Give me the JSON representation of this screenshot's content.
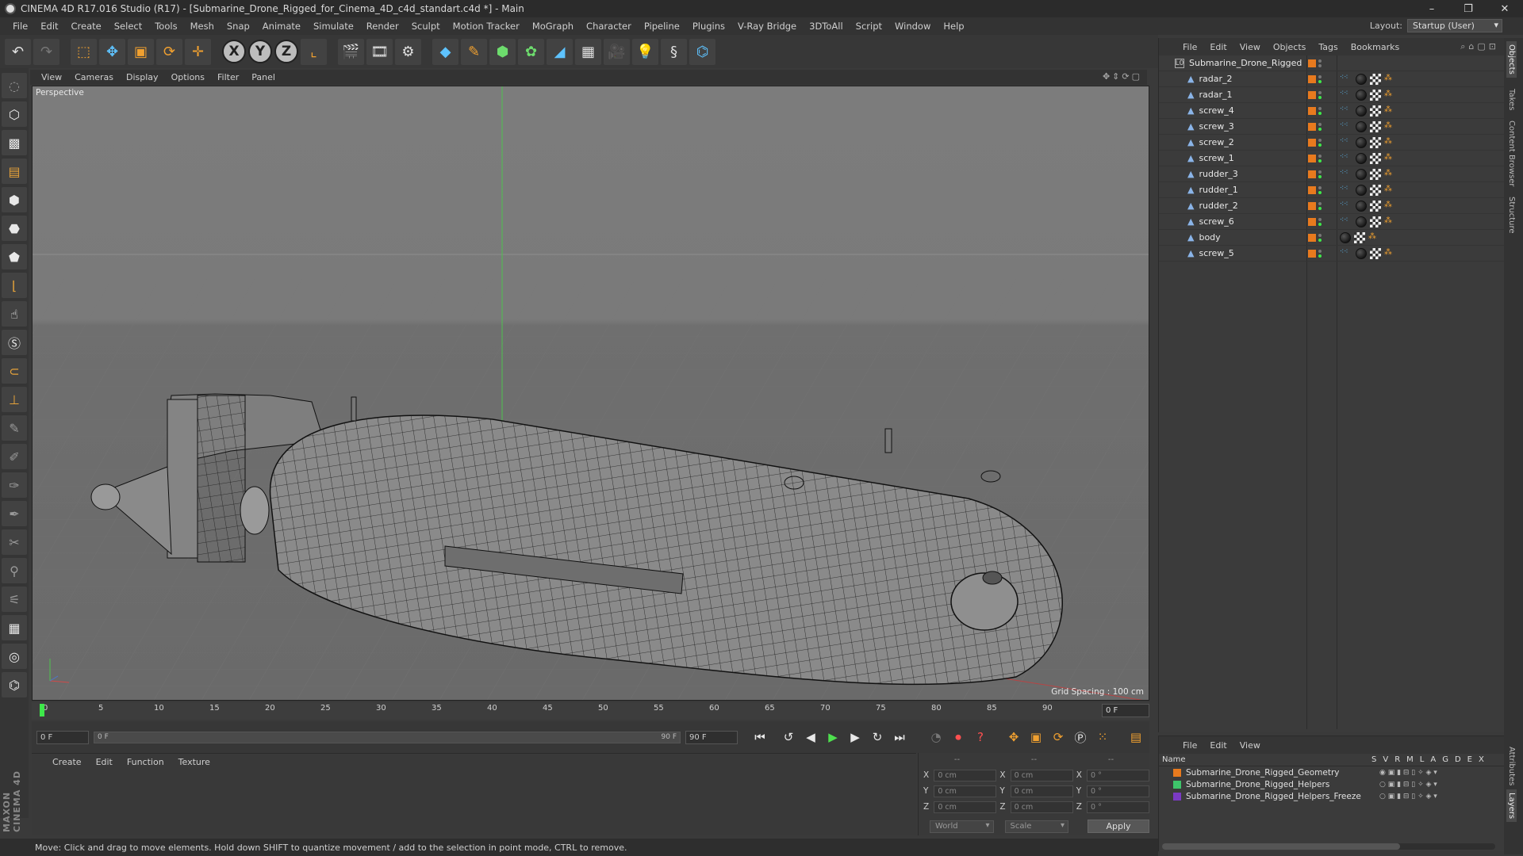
{
  "window": {
    "title": "CINEMA 4D R17.016 Studio (R17) - [Submarine_Drone_Rigged_for_Cinema_4D_c4d_standart.c4d *] - Main",
    "min": "–",
    "restore": "❐",
    "close": "✕"
  },
  "menu": [
    "File",
    "Edit",
    "Create",
    "Select",
    "Tools",
    "Mesh",
    "Snap",
    "Animate",
    "Simulate",
    "Render",
    "Sculpt",
    "Motion Tracker",
    "MoGraph",
    "Character",
    "Pipeline",
    "Plugins",
    "V-Ray Bridge",
    "3DToAll",
    "Script",
    "Window",
    "Help"
  ],
  "layout": {
    "label": "Layout:",
    "value": "Startup (User)"
  },
  "toolbar": {
    "x": "X",
    "y": "Y",
    "z": "Z"
  },
  "viewport": {
    "menu": [
      "View",
      "Cameras",
      "Display",
      "Options",
      "Filter",
      "Panel"
    ],
    "label": "Perspective",
    "grid_spacing": "Grid Spacing : 100 cm"
  },
  "timeline": {
    "ticks": [
      "0",
      "5",
      "10",
      "15",
      "20",
      "25",
      "30",
      "35",
      "40",
      "45",
      "50",
      "55",
      "60",
      "65",
      "70",
      "75",
      "80",
      "85",
      "90"
    ],
    "current_frame": "0 F"
  },
  "transport": {
    "start": "0 F",
    "slider_start": "0 F",
    "slider_end": "90 F",
    "end": "90 F"
  },
  "material": {
    "menu": [
      "Create",
      "Edit",
      "Function",
      "Texture"
    ]
  },
  "coords": {
    "headers": [
      "--",
      "--",
      "--"
    ],
    "rows": [
      {
        "a": "X",
        "v1": "0 cm",
        "b": "X",
        "v2": "0 cm",
        "c": "X",
        "v3": "0 °"
      },
      {
        "a": "Y",
        "v1": "0 cm",
        "b": "Y",
        "v2": "0 cm",
        "c": "Y",
        "v3": "0 °"
      },
      {
        "a": "Z",
        "v1": "0 cm",
        "b": "Z",
        "v2": "0 cm",
        "c": "Z",
        "v3": "0 °"
      }
    ],
    "space": "World",
    "mode": "Scale",
    "apply": "Apply"
  },
  "status": "Move: Click and drag to move elements. Hold down SHIFT to quantize movement / add to the selection in point mode, CTRL to remove.",
  "objects": {
    "menu": [
      "File",
      "Edit",
      "View",
      "Objects",
      "Tags",
      "Bookmarks"
    ],
    "root": "Submarine_Drone_Rigged",
    "items": [
      "radar_2",
      "radar_1",
      "screw_4",
      "screw_3",
      "screw_2",
      "screw_1",
      "rudder_3",
      "rudder_1",
      "rudder_2",
      "screw_6",
      "body",
      "screw_5"
    ]
  },
  "layers": {
    "menu": [
      "File",
      "Edit",
      "View"
    ],
    "name_header": "Name",
    "columns": [
      "S",
      "V",
      "R",
      "M",
      "L",
      "A",
      "G",
      "D",
      "E",
      "X"
    ],
    "items": [
      {
        "name": "Submarine_Drone_Rigged_Geometry",
        "color": "#e87a1e"
      },
      {
        "name": "Submarine_Drone_Rigged_Helpers",
        "color": "#3ec46a"
      },
      {
        "name": "Submarine_Drone_Rigged_Helpers_Freeze",
        "color": "#7a3ac4"
      }
    ]
  },
  "side_tabs": [
    "Objects",
    "Takes",
    "Content Browser",
    "Structure",
    "Attributes",
    "Layers"
  ],
  "brand": "MAXON CINEMA 4D"
}
